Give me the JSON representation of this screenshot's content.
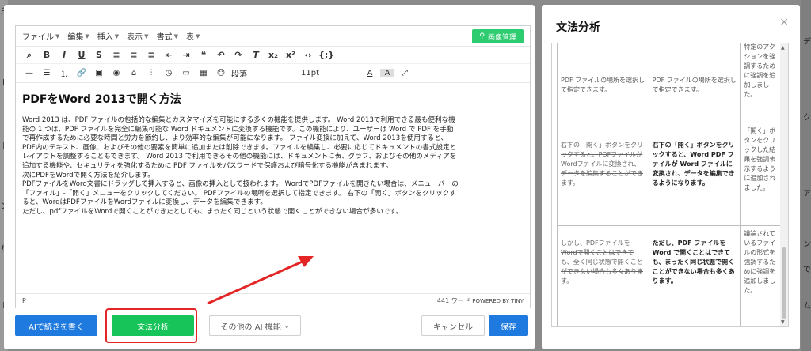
{
  "background": {
    "left_chars": [
      "印",
      "ド",
      "ト",
      "ン",
      "り",
      "ト"
    ],
    "right_chars": [
      "デ",
      "ク",
      "ア",
      "ン",
      "で",
      "ム"
    ]
  },
  "menubar": {
    "items": [
      "ファイル",
      "編集",
      "挿入",
      "表示",
      "書式",
      "表"
    ],
    "image_button": "画像管理"
  },
  "toolbar2": {
    "paragraph": "段落",
    "fontsize": "11pt"
  },
  "doc": {
    "title": "PDFをWord 2013で開く方法",
    "lines": [
      "Word 2013 は、PDF ファイルの包括的な編集とカスタマイズを可能にする多くの機能を提供します。 Word 2013で利用できる最も便利な機",
      "能の 1 つは、PDF ファイルを完全に編集可能な Word ドキュメントに変換する機能です。この機能により、ユーザーは Word で PDF を手動",
      "で再作成するために必要な時間と労力を節約し、より効率的な編集が可能になります。 ファイル変換に加えて、Word 2013を使用すると、",
      "PDF内のテキスト、画像、およびその他の要素を簡単に追加または削除できます。ファイルを編集し、必要に応じてドキュメントの書式設定と",
      "レイアウトを調整することもできます。 Word 2013 で利用できるその他の機能には、ドキュメントに表、グラフ、およびその他のメディアを",
      "追加する機能や、セキュリティを強化するために PDF ファイルをパスワードで保護および暗号化する機能が含まれます。",
      "次にPDFをWordで開く方法を紹介します。",
      "PDFファイルをWord文書にドラッグして挿入すると、画像の挿入として扱われます。 WordでPDFファイルを開きたい場合は、メニューバーの",
      "「ファイル」-「開く」メニューをクリックしてください。 PDFファイルの場所を選択して指定できます。 右下の「開く」ボタンをクリックす",
      "ると、WordはPDFファイルをWordファイルに変換し、データを編集できます。",
      "ただし、pdfファイルをWordで開くことができたとしても、まったく同じという状態で開くことができない場合が多いです。"
    ]
  },
  "status": {
    "path": "P",
    "words": "441 ワード",
    "powered": "POWERED BY TINY"
  },
  "buttons": {
    "ai_continue": "AIで続きを書く",
    "grammar": "文法分析",
    "other_ai": "その他の AI 機能",
    "cancel": "キャンセル",
    "save": "保存"
  },
  "panel": {
    "title": "文法分析",
    "close": "×",
    "rows": [
      {
        "orig": "PDF ファイルの場所を選択して指定できます。",
        "fixed": "PDF ファイルの場所を選択して指定できます。",
        "note": "特定のアクションを強調するために強調を追加しました。"
      },
      {
        "orig": "右下の「開く」ボタンをクリックすると、PDFファイルがWordファイルに変換され、データを編集することができます。",
        "fixed": "右下の「開く」ボタンをクリックすると、Word PDF ファイルが Word ファイルに変換され、データを編集できるようになります。",
        "note": "「開く」ボタンをクリックした結果を強調表示するように追加されました。"
      },
      {
        "orig": "しかし、PDFファイルをWordで開くことはできても、全く同じ状態で開くことができない場合も多々あります。",
        "fixed": "ただし、PDF ファイルを Word で開くことはできても、まったく同じ状態で開くことができない場合も多くあります。",
        "note": "議論されているファイルの形式を強調するために強調を追加しました。"
      }
    ]
  }
}
